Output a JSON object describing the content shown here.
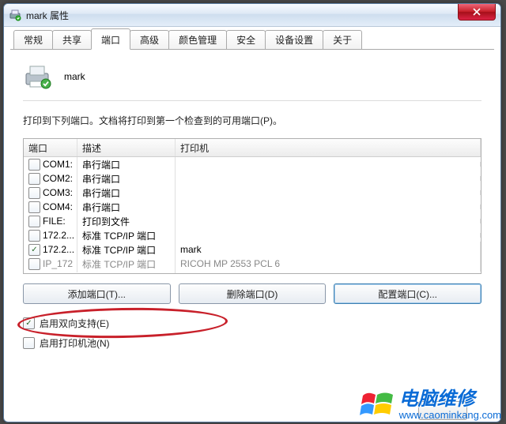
{
  "window": {
    "title": "mark 属性"
  },
  "tabs": [
    "常规",
    "共享",
    "端口",
    "高级",
    "颜色管理",
    "安全",
    "设备设置",
    "关于"
  ],
  "active_tab_index": 2,
  "printer_name": "mark",
  "description": "打印到下列端口。文档将打印到第一个检查到的可用端口(P)。",
  "columns": {
    "port": "端口",
    "desc": "描述",
    "printer": "打印机"
  },
  "rows": [
    {
      "checked": false,
      "port": "COM1:",
      "desc": "串行端口",
      "printer": ""
    },
    {
      "checked": false,
      "port": "COM2:",
      "desc": "串行端口",
      "printer": ""
    },
    {
      "checked": false,
      "port": "COM3:",
      "desc": "串行端口",
      "printer": ""
    },
    {
      "checked": false,
      "port": "COM4:",
      "desc": "串行端口",
      "printer": ""
    },
    {
      "checked": false,
      "port": "FILE:",
      "desc": "打印到文件",
      "printer": ""
    },
    {
      "checked": false,
      "port": "172.2...",
      "desc": "标准 TCP/IP 端口",
      "printer": ""
    },
    {
      "checked": true,
      "port": "172.2...",
      "desc": "标准 TCP/IP 端口",
      "printer": "mark"
    },
    {
      "checked": false,
      "port": "IP_172",
      "desc": "标准 TCP/IP 端口",
      "printer": "RICOH MP 2553 PCL 6",
      "cut": true
    }
  ],
  "buttons": {
    "add": "添加端口(T)...",
    "del": "删除端口(D)",
    "cfg": "配置端口(C)..."
  },
  "options": {
    "bidi": {
      "checked": true,
      "label": "启用双向支持(E)"
    },
    "pool": {
      "checked": false,
      "label": "启用打印机池(N)"
    }
  },
  "watermark": {
    "line1": "电脑维修",
    "line2": "www.caominkang.com"
  }
}
